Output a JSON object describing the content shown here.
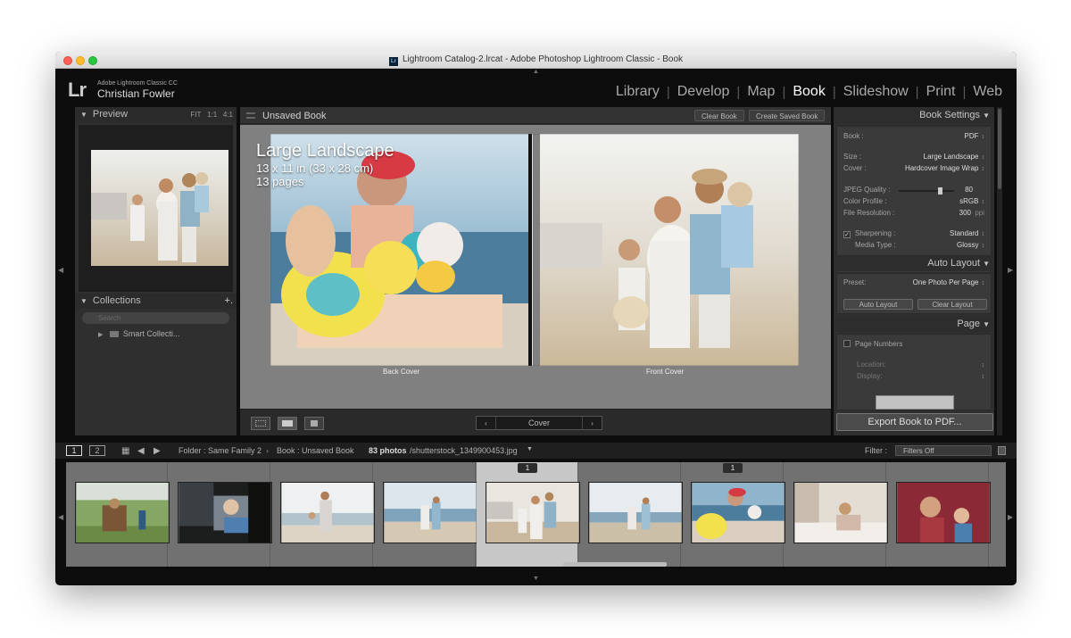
{
  "window": {
    "title": "Lightroom Catalog-2.lrcat - Adobe Photoshop Lightroom Classic - Book"
  },
  "identity": {
    "logo": "Lr",
    "product": "Adobe Lightroom Classic CC",
    "user": "Christian Fowler"
  },
  "modules": [
    {
      "label": "Library",
      "active": false
    },
    {
      "label": "Develop",
      "active": false
    },
    {
      "label": "Map",
      "active": false
    },
    {
      "label": "Book",
      "active": true
    },
    {
      "label": "Slideshow",
      "active": false
    },
    {
      "label": "Print",
      "active": false
    },
    {
      "label": "Web",
      "active": false
    }
  ],
  "left": {
    "preview": {
      "label": "Preview",
      "zoom": [
        "FIT",
        "1:1",
        "4:1"
      ]
    },
    "collections": {
      "label": "Collections",
      "add": "+.",
      "search_placeholder": "Search",
      "items": [
        {
          "label": "Smart Collecti..."
        }
      ]
    }
  },
  "center": {
    "title": "Unsaved Book",
    "clear_button": "Clear Book",
    "create_button": "Create Saved Book",
    "book_label": {
      "size": "Large Landscape",
      "dimensions": "13 x 11 in (33 x 28 cm)",
      "pages": "13 pages"
    },
    "back_cover": "Back Cover",
    "front_cover": "Front Cover",
    "page_nav": {
      "label": "Cover",
      "prev": "‹",
      "next": "›"
    }
  },
  "right": {
    "book_settings": {
      "header": "Book Settings",
      "book": {
        "label": "Book :",
        "value": "PDF"
      },
      "size": {
        "label": "Size :",
        "value": "Large Landscape"
      },
      "cover": {
        "label": "Cover :",
        "value": "Hardcover Image Wrap"
      },
      "jpeg_quality": {
        "label": "JPEG Quality :",
        "value": "80"
      },
      "color_profile": {
        "label": "Color Profile :",
        "value": "sRGB"
      },
      "file_resolution": {
        "label": "File Resolution :",
        "value": "300",
        "unit": "ppi"
      },
      "sharpening": {
        "label": "Sharpening :",
        "value": "Standard",
        "checked": true
      },
      "media_type": {
        "label": "Media Type :",
        "value": "Glossy"
      }
    },
    "auto_layout": {
      "header": "Auto Layout",
      "preset_label": "Preset:",
      "preset_value": "One Photo Per Page",
      "auto_button": "Auto Layout",
      "clear_button": "Clear Layout"
    },
    "page": {
      "header": "Page",
      "page_numbers": "Page Numbers",
      "location": "Location:",
      "display": "Display:"
    },
    "export_button": "Export Book to PDF..."
  },
  "filmstrip_bar": {
    "monitor1": "1",
    "monitor2": "2",
    "source": "Folder : Same Family 2",
    "book": "Book : Unsaved Book",
    "count": "83 photos",
    "file": "/shutterstock_1349900453.jpg",
    "filter_label": "Filter :",
    "filter_value": "Filters Off"
  },
  "filmstrip": {
    "thumbnails": [
      {
        "name": "thumb-1",
        "badge": ""
      },
      {
        "name": "thumb-2",
        "badge": ""
      },
      {
        "name": "thumb-3",
        "badge": ""
      },
      {
        "name": "thumb-4",
        "badge": ""
      },
      {
        "name": "thumb-5",
        "badge": "1",
        "selected": true
      },
      {
        "name": "thumb-6",
        "badge": ""
      },
      {
        "name": "thumb-7",
        "badge": "1"
      },
      {
        "name": "thumb-8",
        "badge": ""
      },
      {
        "name": "thumb-9",
        "badge": ""
      }
    ]
  },
  "colors": {
    "background": "#0d0d0d",
    "panel": "#3a3a3a",
    "stage": "#808080",
    "active_module": "#ffffff"
  }
}
